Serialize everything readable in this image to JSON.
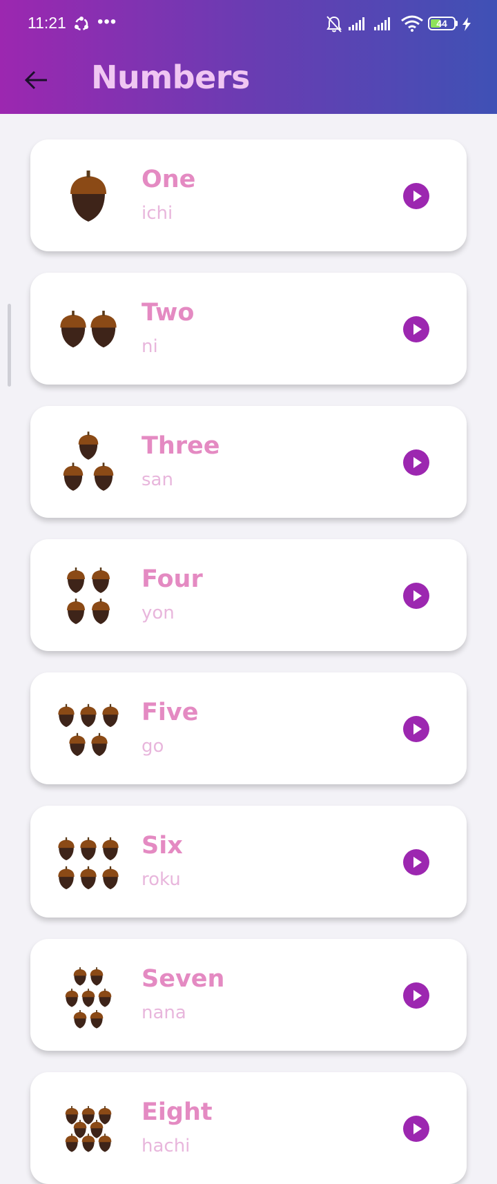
{
  "status_bar": {
    "time": "11:21",
    "more": "•••",
    "battery": "44"
  },
  "app_bar": {
    "title": "Numbers",
    "back_icon": "arrow-back-icon"
  },
  "colors": {
    "gradient_start": "#9c27b0",
    "gradient_end": "#3f51b5",
    "title": "#f0c6f2",
    "word": "#e48ac2",
    "translation": "#e8b6dc",
    "play_button": "#9c27b0",
    "acorn_cap": "#8b4a16",
    "acorn_body": "#3e2419"
  },
  "numbers": [
    {
      "word": "One",
      "translation": "ichi",
      "count": 1,
      "icon": "play-icon"
    },
    {
      "word": "Two",
      "translation": "ni",
      "count": 2,
      "icon": "play-icon"
    },
    {
      "word": "Three",
      "translation": "san",
      "count": 3,
      "icon": "play-icon"
    },
    {
      "word": "Four",
      "translation": "yon",
      "count": 4,
      "icon": "play-icon"
    },
    {
      "word": "Five",
      "translation": "go",
      "count": 5,
      "icon": "play-icon"
    },
    {
      "word": "Six",
      "translation": "roku",
      "count": 6,
      "icon": "play-icon"
    },
    {
      "word": "Seven",
      "translation": "nana",
      "count": 7,
      "icon": "play-icon"
    },
    {
      "word": "Eight",
      "translation": "hachi",
      "count": 8,
      "icon": "play-icon"
    }
  ]
}
